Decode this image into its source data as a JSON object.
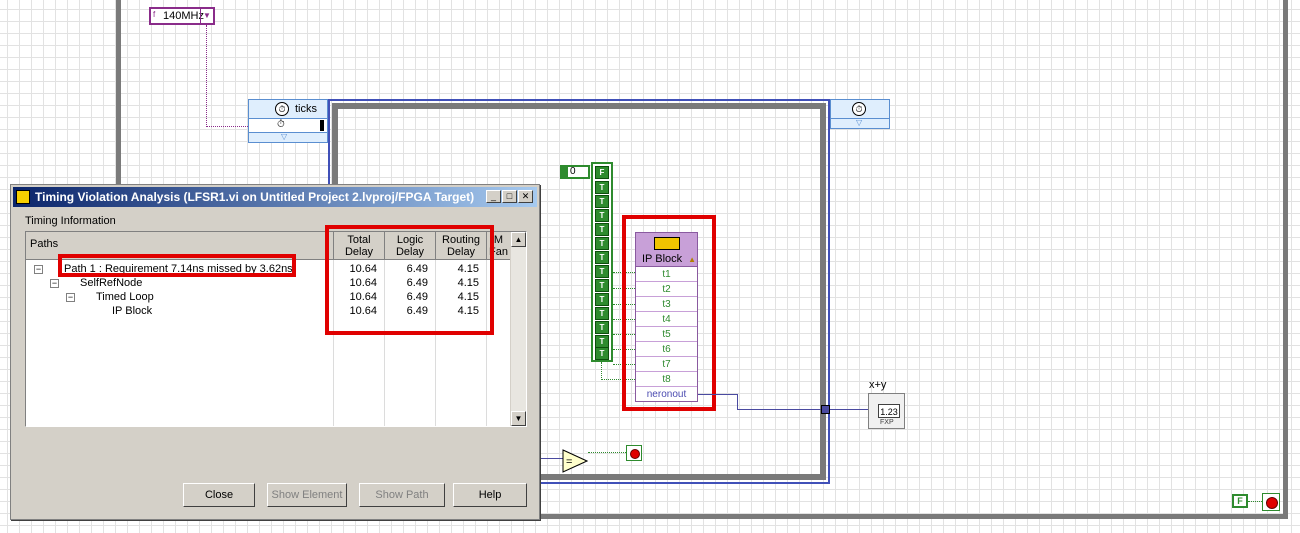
{
  "diagram": {
    "clock_constant": "140MHz",
    "ticks_label": "ticks",
    "numeric_constant": "0",
    "bool_false_label": "F",
    "bool_true_label": "T",
    "ip_block": {
      "title": "IP Block",
      "inputs": [
        "t1",
        "t2",
        "t3",
        "t4",
        "t5",
        "t6",
        "t7",
        "t8"
      ],
      "output": "neronout"
    },
    "add_label": "x+y",
    "indicator_value": "1.23",
    "indicator_type": "FXP"
  },
  "dialog": {
    "title": "Timing Violation Analysis (LFSR1.vi on Untitled Project 2.lvproj/FPGA Target)",
    "group_label": "Timing Information",
    "columns": {
      "paths": "Paths",
      "total_delay": [
        "Total",
        "Delay"
      ],
      "logic_delay": [
        "Logic",
        "Delay"
      ],
      "routing_delay": [
        "Routing",
        "Delay"
      ],
      "max_fanout": [
        "M",
        "Fan"
      ]
    },
    "rows": [
      {
        "label": "Path 1 : Requirement 7.14ns missed by 3.62ns",
        "total": "10.64",
        "logic": "6.49",
        "routing": "4.15"
      },
      {
        "label": "SelfRefNode",
        "total": "10.64",
        "logic": "6.49",
        "routing": "4.15"
      },
      {
        "label": "Timed Loop",
        "total": "10.64",
        "logic": "6.49",
        "routing": "4.15"
      },
      {
        "label": "IP Block",
        "total": "10.64",
        "logic": "6.49",
        "routing": "4.15"
      }
    ],
    "buttons": {
      "close": "Close",
      "show_element": "Show Element",
      "show_path": "Show Path",
      "help": "Help"
    }
  },
  "colors": {
    "highlight": "#e00000",
    "titlebar_start": "#0a246a",
    "titlebar_end": "#a6caf0",
    "loop_border": "#6e6e6e",
    "boolean_green": "#2e8b2e",
    "ip_block_header": "#c8a0d8"
  }
}
